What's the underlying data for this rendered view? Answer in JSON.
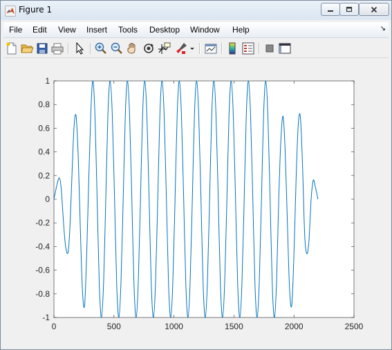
{
  "window": {
    "title": "Figure 1"
  },
  "menu": {
    "items": [
      "File",
      "Edit",
      "View",
      "Insert",
      "Tools",
      "Desktop",
      "Window",
      "Help"
    ]
  },
  "toolbar": {
    "icons": [
      "new-figure-icon",
      "open-file-icon",
      "save-icon",
      "print-icon",
      "edit-plot-arrow-icon",
      "zoom-in-icon",
      "zoom-out-icon",
      "pan-hand-icon",
      "rotate-3d-icon",
      "data-cursor-icon",
      "brush-icon",
      "brush-dropdown-icon",
      "link-plot-icon",
      "insert-colorbar-icon",
      "insert-legend-icon",
      "hide-plot-tools-icon",
      "show-plot-tools-icon"
    ]
  },
  "chart_data": {
    "type": "line",
    "title": "",
    "xlabel": "",
    "ylabel": "",
    "xlim": [
      0,
      2500
    ],
    "ylim": [
      -1,
      1
    ],
    "xticks": [
      0,
      500,
      1000,
      1500,
      2000,
      2500
    ],
    "yticks": [
      1,
      0.8,
      0.6,
      0.4,
      0.2,
      0,
      -0.2,
      -0.4,
      -0.6,
      -0.8,
      -1
    ],
    "xtick_labels": [
      "0",
      "500",
      "1000",
      "1500",
      "2000",
      "2500"
    ],
    "ytick_labels": [
      "1",
      "0.8",
      "0.6",
      "0.4",
      "0.2",
      "0",
      "-0.2",
      "-0.4",
      "-0.6",
      "-0.8",
      "-1"
    ],
    "grid": false,
    "series": [
      {
        "color": "#0072bd",
        "x": [
          0,
          25,
          45,
          60,
          75,
          95,
          118,
          135,
          152,
          168,
          185,
          203,
          220,
          238,
          255,
          272,
          290,
          308,
          325,
          342,
          360,
          378,
          396,
          414,
          432,
          450,
          468,
          487,
          505,
          523,
          541,
          559,
          577,
          595,
          613,
          631,
          649,
          667,
          685,
          703,
          721,
          739,
          757,
          775,
          793,
          811,
          829,
          847,
          865,
          883,
          901,
          919,
          937,
          955,
          973,
          991,
          1009,
          1027,
          1045,
          1063,
          1081,
          1099,
          1117,
          1135,
          1153,
          1171,
          1189,
          1207,
          1225,
          1243,
          1261,
          1279,
          1297,
          1315,
          1333,
          1351,
          1369,
          1387,
          1405,
          1423,
          1441,
          1459,
          1477,
          1495,
          1513,
          1531,
          1549,
          1567,
          1585,
          1603,
          1621,
          1639,
          1657,
          1675,
          1693,
          1711,
          1729,
          1747,
          1765,
          1783,
          1801,
          1819,
          1837,
          1855,
          1873,
          1891,
          1909,
          1927,
          1945,
          1963,
          1981,
          1999,
          2017,
          2035,
          2053,
          2071,
          2089,
          2107,
          2125,
          2143,
          2161,
          2179,
          2200
        ],
        "y": [
          0,
          0.12,
          0.18,
          0.1,
          -0.12,
          -0.38,
          -0.45,
          -0.2,
          0.25,
          0.62,
          0.7,
          0.35,
          -0.25,
          -0.78,
          -0.9,
          -0.5,
          0.15,
          0.75,
          1.0,
          0.7,
          0.0,
          -0.72,
          -1.0,
          -0.7,
          0.0,
          0.72,
          1.0,
          0.7,
          0.0,
          -0.72,
          -1.0,
          -0.7,
          0.0,
          0.72,
          1.0,
          0.7,
          0.0,
          -0.72,
          -1.0,
          -0.7,
          0.0,
          0.72,
          1.0,
          0.7,
          0.0,
          -0.72,
          -1.0,
          -0.7,
          0.0,
          0.72,
          1.0,
          0.7,
          0.0,
          -0.72,
          -1.0,
          -0.7,
          0.0,
          0.72,
          1.0,
          0.7,
          0.0,
          -0.72,
          -1.0,
          -0.7,
          0.0,
          0.72,
          1.0,
          0.7,
          0.0,
          -0.72,
          -1.0,
          -0.7,
          0.0,
          0.72,
          1.0,
          0.7,
          0.0,
          -0.72,
          -1.0,
          -0.7,
          0.0,
          0.72,
          1.0,
          0.7,
          0.0,
          -0.72,
          -1.0,
          -0.7,
          0.0,
          0.72,
          1.0,
          0.7,
          0.0,
          -0.72,
          -1.0,
          -0.7,
          0.0,
          0.72,
          1.0,
          0.7,
          0.0,
          -0.72,
          -1.0,
          -0.7,
          0.0,
          0.5,
          0.7,
          0.4,
          -0.2,
          -0.75,
          -0.9,
          -0.5,
          0.15,
          0.62,
          0.7,
          0.3,
          -0.3,
          -0.46,
          -0.35,
          0.0,
          0.16,
          0.1,
          0.0
        ]
      }
    ]
  }
}
